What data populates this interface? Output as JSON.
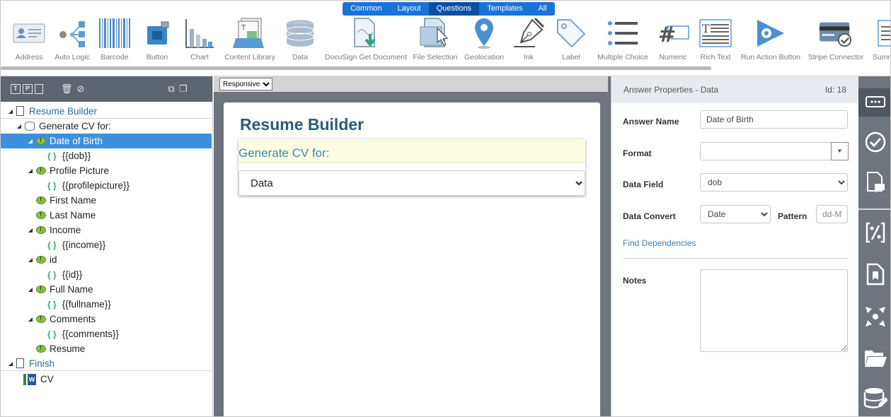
{
  "toolbar": {
    "category_tabs": [
      "Common",
      "Layout",
      "Questions",
      "Templates",
      "All"
    ],
    "active_tab": "Questions",
    "tools": [
      {
        "label": "Address",
        "icon": "address-card-icon"
      },
      {
        "label": "Auto Logic",
        "icon": "auto-logic-icon"
      },
      {
        "label": "Barcode",
        "icon": "barcode-icon"
      },
      {
        "label": "Button",
        "icon": "button-icon"
      },
      {
        "label": "Chart",
        "icon": "chart-icon"
      },
      {
        "label": "Content Library",
        "icon": "content-library-icon"
      },
      {
        "label": "Data",
        "icon": "database-icon"
      },
      {
        "label": "DocuSign Get Document",
        "icon": "docusign-icon"
      },
      {
        "label": "File Selection",
        "icon": "file-selection-icon"
      },
      {
        "label": "Geolocation",
        "icon": "map-pin-icon"
      },
      {
        "label": "Ink",
        "icon": "pen-nib-icon"
      },
      {
        "label": "Label",
        "icon": "tag-icon"
      },
      {
        "label": "Multiple Choice",
        "icon": "list-icon"
      },
      {
        "label": "Numeric",
        "icon": "hash-icon"
      },
      {
        "label": "Rich Text",
        "icon": "rich-text-icon"
      },
      {
        "label": "Run Action Button",
        "icon": "gear-arrow-icon"
      },
      {
        "label": "Stripe Connector",
        "icon": "credit-card-icon"
      },
      {
        "label": "Summ",
        "icon": "summary-icon"
      }
    ]
  },
  "tree": {
    "toolbar_glyphs": [
      "T",
      "P",
      "I"
    ],
    "nodes": [
      {
        "label": "Resume Builder",
        "type": "page"
      },
      {
        "label": "Generate CV for:",
        "type": "data"
      },
      {
        "label": "Date of Birth",
        "type": "question"
      },
      {
        "label": "{{dob}}",
        "type": "var"
      },
      {
        "label": "Profile Picture",
        "type": "question"
      },
      {
        "label": "{{profilepicture}}",
        "type": "var"
      },
      {
        "label": "First Name",
        "type": "question"
      },
      {
        "label": "Last Name",
        "type": "question"
      },
      {
        "label": "Income",
        "type": "question"
      },
      {
        "label": "{{income}}",
        "type": "var"
      },
      {
        "label": "id",
        "type": "question"
      },
      {
        "label": "{{id}}",
        "type": "var"
      },
      {
        "label": "Full Name",
        "type": "question"
      },
      {
        "label": "{{fullname}}",
        "type": "var"
      },
      {
        "label": "Comments",
        "type": "question"
      },
      {
        "label": "{{comments}}",
        "type": "var"
      },
      {
        "label": "Resume",
        "type": "question"
      },
      {
        "label": "Finish",
        "type": "page"
      },
      {
        "label": "CV",
        "type": "word"
      }
    ]
  },
  "canvas": {
    "layout_mode": "Responsive",
    "page_title": "Resume Builder",
    "question_text": "Generate CV for:",
    "answer_value": "Data"
  },
  "properties": {
    "header_title": "Answer Properties - Data",
    "header_id": "Id: 18",
    "answer_name_label": "Answer Name",
    "answer_name_value": "Date of Birth",
    "format_label": "Format",
    "format_value": "",
    "data_field_label": "Data Field",
    "data_field_value": "dob",
    "data_convert_label": "Data Convert",
    "data_convert_value": "Date",
    "pattern_label": "Pattern",
    "pattern_value": "dd-M",
    "find_dependencies": "Find Dependencies",
    "notes_label": "Notes"
  },
  "colors": {
    "accent": "#1a73d9",
    "selected_row": "#3d8fdb",
    "panel_dark": "#6f757d",
    "title_color": "#2b5c76",
    "question_color": "#3a86b2"
  }
}
